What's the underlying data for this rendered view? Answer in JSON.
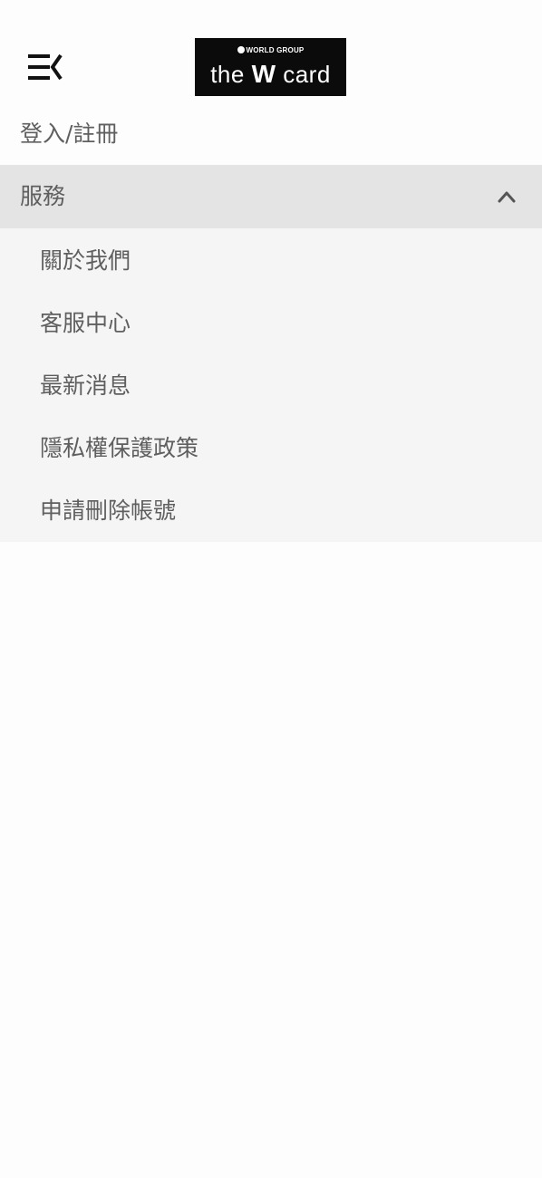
{
  "header": {
    "menu_icon": "menu-collapse-icon",
    "logo": {
      "top_text": "WORLD GROUP",
      "main_prefix": "the ",
      "main_w": "W",
      "main_suffix": " card"
    }
  },
  "login_label": "登入/註冊",
  "services": {
    "title": "服務",
    "expanded": true,
    "toggle_icon": "chevron-up-icon",
    "items": [
      {
        "label": "關於我們"
      },
      {
        "label": "客服中心"
      },
      {
        "label": "最新消息"
      },
      {
        "label": "隱私權保護政策"
      },
      {
        "label": "申請刪除帳號"
      }
    ]
  },
  "colors": {
    "background": "#fdfdfd",
    "section_header_bg": "#e4e4e4",
    "submenu_bg": "#f5f5f5",
    "text": "#5f5f5f",
    "logo_bg": "#0b0b0b"
  }
}
